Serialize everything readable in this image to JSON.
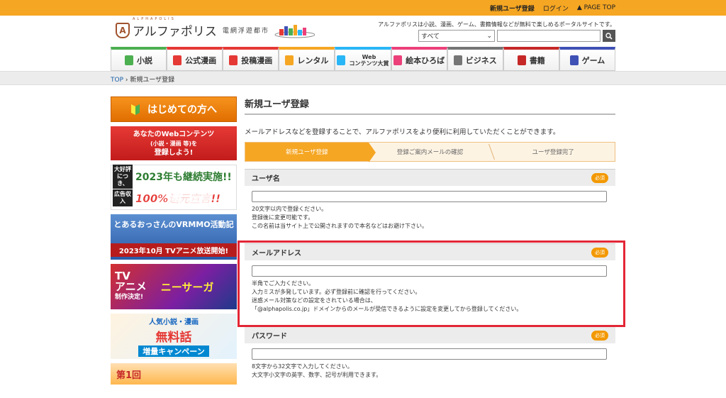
{
  "topbar": {
    "new_user": "新規ユーザ登録",
    "login": "ログイン",
    "page_top": "▲ PAGE TOP"
  },
  "header": {
    "logo_text": "アルファポリス",
    "logo_sub": "電網浮遊都市",
    "logo_latin": "ALPHAPOLIS",
    "tagline": "アルファポリスは小説、漫画、ゲーム、書籍情報などが無料で楽しめるポータルサイトです。",
    "search_select": "すべて",
    "search_button": "🔍"
  },
  "nav": {
    "items": [
      {
        "label": "小説",
        "color": "#4caf50"
      },
      {
        "label": "公式漫画",
        "color": "#e53935"
      },
      {
        "label": "投稿漫画",
        "color": "#e53935"
      },
      {
        "label": "レンタル",
        "color": "#f5a623"
      },
      {
        "label": "Web\nコンテンツ大賞",
        "color": "#29b6f6"
      },
      {
        "label": "絵本ひろば",
        "color": "#ec407a"
      },
      {
        "label": "ビジネス",
        "color": "#757575"
      },
      {
        "label": "書籍",
        "color": "#c62828"
      },
      {
        "label": "ゲーム",
        "color": "#3f51b5"
      }
    ]
  },
  "breadcrumb": {
    "top": "TOP",
    "sep": " › ",
    "current": "新規ユーザ登録"
  },
  "sidebar": {
    "banner1": "はじめての方へ",
    "banner2_l1": "あなたのWebコンテンツ",
    "banner2_l2": "(小説・漫画 等)を",
    "banner2_l3": "登録しよう!",
    "banner3_tag1": "大好評につき、",
    "banner3_text1": "2023年も継続実施!!",
    "banner3_tag2": "広告収入",
    "banner3_text2": "100%還元宣言!!",
    "banner4_title": "とあるおっさんのVRMMO活動記",
    "banner4_bottom": "2023年10月 TVアニメ放送開始!",
    "banner5_tv": "TV",
    "banner5_anime": "アニメ",
    "banner5_decided": "制作決定!",
    "banner5_title": "ニーサーガ",
    "banner6_l1": "人気小説・漫画",
    "banner6_l2": "無料話",
    "banner6_l3": "増量キャンペーン",
    "banner7": "第1回"
  },
  "main": {
    "title": "新規ユーザ登録",
    "lead": "メールアドレスなどを登録することで、アルファポリスをより便利に利用していただくことができます。",
    "steps": [
      "新規ユーザ登録",
      "登録ご案内メールの確認",
      "ユーザ登録完了"
    ],
    "required": "必須",
    "username": {
      "label": "ユーザ名",
      "notes": [
        "20文字以内で登録ください。",
        "登録後に変更可能です。",
        "この名前は当サイト上で公開されますので本名などはお避け下さい。"
      ]
    },
    "email": {
      "label": "メールアドレス",
      "notes": [
        "半角でご入力ください。",
        "入力ミスが多発しています。必ず登録前に確認を行ってください。",
        "迷惑メール対策などの設定をされている場合は、",
        "「@alphapolis.co.jp」ドメインからのメールが受信できるように設定を変更してから登録してください。"
      ]
    },
    "password": {
      "label": "パスワード",
      "notes": [
        "8文字から32文字で入力してください。",
        "大文字小文字の英字、数字、記号が利用できます。"
      ]
    }
  }
}
